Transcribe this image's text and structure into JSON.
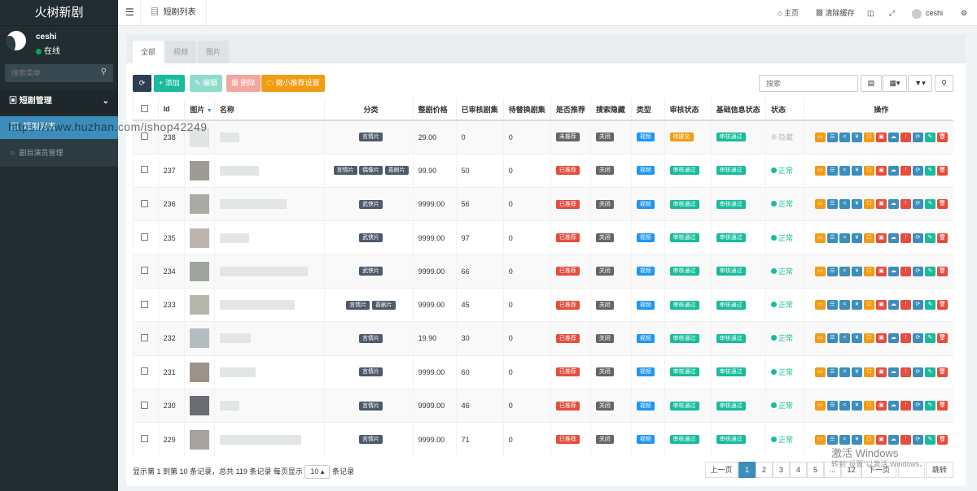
{
  "app": {
    "brand": "火树新剧"
  },
  "user": {
    "name": "ceshi",
    "status": "在线"
  },
  "sidebar": {
    "search_placeholder": "搜索菜单",
    "group": "短剧管理",
    "items": [
      {
        "label": "短剧列表"
      },
      {
        "label": "剧目演员管理"
      }
    ]
  },
  "topbar": {
    "tab": "短剧列表",
    "home": "主页",
    "clear_cache": "清除缓存",
    "username": "ceshi"
  },
  "tabs": [
    "全部",
    "视频",
    "图片"
  ],
  "toolbar": {
    "add": "添加",
    "edit": "编辑",
    "delete": "删除",
    "wx_rec": "微小推荐设置",
    "search_placeholder": "搜索"
  },
  "columns": [
    "Id",
    "图片",
    "名称",
    "分类",
    "整剧价格",
    "已审核剧集",
    "待替换剧集",
    "是否推荐",
    "搜索隐藏",
    "类型",
    "审核状态",
    "基础信息状态",
    "状态",
    "操作"
  ],
  "rows": [
    {
      "id": "238",
      "cats": [
        "言情片"
      ],
      "price": "29.00",
      "audited": "0",
      "pending": "0",
      "rec": "未推荐",
      "hide": "关闭",
      "type": "视频",
      "audit": "待提交",
      "base": "审核通过",
      "state": "隐藏",
      "pic": "#dfe5e2",
      "nm": 24
    },
    {
      "id": "237",
      "cats": [
        "言情片",
        "偶像片",
        "喜剧片"
      ],
      "price": "99.90",
      "audited": "50",
      "pending": "0",
      "rec": "已推荐",
      "hide": "关闭",
      "type": "视频",
      "audit": "审核通过",
      "base": "审核通过",
      "state": "正常",
      "pic": "#9f9a93",
      "nm": 48
    },
    {
      "id": "236",
      "cats": [
        "武侠片"
      ],
      "price": "9999.00",
      "audited": "56",
      "pending": "0",
      "rec": "已推荐",
      "hide": "关闭",
      "type": "视频",
      "audit": "审核通过",
      "base": "审核通过",
      "state": "正常",
      "pic": "#a9aba4",
      "nm": 82
    },
    {
      "id": "235",
      "cats": [
        "武侠片"
      ],
      "price": "9999.00",
      "audited": "97",
      "pending": "0",
      "rec": "已推荐",
      "hide": "关闭",
      "type": "视频",
      "audit": "审核通过",
      "base": "审核通过",
      "state": "正常",
      "pic": "#bdb5ae",
      "nm": 36
    },
    {
      "id": "234",
      "cats": [
        "武侠片"
      ],
      "price": "9999.00",
      "audited": "66",
      "pending": "0",
      "rec": "已推荐",
      "hide": "关闭",
      "type": "视频",
      "audit": "审核通过",
      "base": "审核通过",
      "state": "正常",
      "pic": "#a0a49e",
      "nm": 108
    },
    {
      "id": "233",
      "cats": [
        "言情片",
        "喜剧片"
      ],
      "price": "9999.00",
      "audited": "45",
      "pending": "0",
      "rec": "已推荐",
      "hide": "关闭",
      "type": "视频",
      "audit": "审核通过",
      "base": "审核通过",
      "state": "正常",
      "pic": "#b3b8ab",
      "nm": 92
    },
    {
      "id": "232",
      "cats": [
        "言情片"
      ],
      "price": "19.90",
      "audited": "30",
      "pending": "0",
      "rec": "已推荐",
      "hide": "关闭",
      "type": "视频",
      "audit": "审核通过",
      "base": "审核通过",
      "state": "正常",
      "pic": "#b5bdc1",
      "nm": 38
    },
    {
      "id": "231",
      "cats": [
        "言情片"
      ],
      "price": "9999.00",
      "audited": "60",
      "pending": "0",
      "rec": "已推荐",
      "hide": "关闭",
      "type": "视频",
      "audit": "审核通过",
      "base": "审核通过",
      "state": "正常",
      "pic": "#9d9289",
      "nm": 44
    },
    {
      "id": "230",
      "cats": [
        "言情片"
      ],
      "price": "9999.00",
      "audited": "46",
      "pending": "0",
      "rec": "已推荐",
      "hide": "关闭",
      "type": "视频",
      "audit": "审核通过",
      "base": "审核通过",
      "state": "正常",
      "pic": "#6a6d73",
      "nm": 24
    },
    {
      "id": "229",
      "cats": [
        "言情片"
      ],
      "price": "9999.00",
      "audited": "71",
      "pending": "0",
      "rec": "已推荐",
      "hide": "关闭",
      "type": "视频",
      "audit": "审核通过",
      "base": "审核通过",
      "state": "正常",
      "pic": "#aaa29d",
      "nm": 100
    }
  ],
  "footer": {
    "summary": "显示第 1 到第 10 条记录，总共 119 条记录 每页显示",
    "page_size": "10",
    "suffix": "条记录"
  },
  "pagination": [
    "上一页",
    "1",
    "2",
    "3",
    "4",
    "5",
    "...",
    "12",
    "下一页",
    "",
    "跳转"
  ],
  "watermark": "https://www.huzhan.com/ishop42249",
  "windows": {
    "line1": "激活 Windows",
    "line2": "转到\"设置\"以激活 Windows。"
  }
}
